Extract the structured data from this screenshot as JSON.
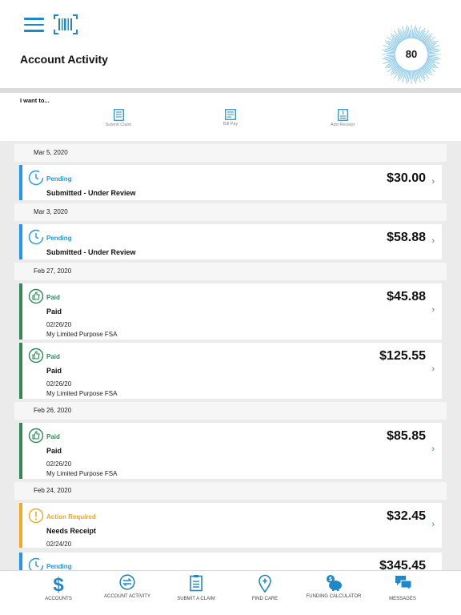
{
  "colors": {
    "accent": "#1e88c8",
    "pending": "#2196f3",
    "paid": "#2e8b57",
    "action_required": "#f5a623"
  },
  "header": {
    "title": "Account Activity",
    "score": "80",
    "icons": [
      "hamburger-menu-icon",
      "barcode-scan-icon"
    ]
  },
  "quick_actions": {
    "label": "I want to...",
    "items": [
      {
        "label": "Submit Claim",
        "icon": "claim-form-icon"
      },
      {
        "label": "Bill Pay",
        "icon": "bill-icon"
      },
      {
        "label": "Add Receipt",
        "icon": "receipt-icon"
      }
    ]
  },
  "activity": [
    {
      "date": "Mar 5, 2020",
      "items": [
        {
          "status": "Pending",
          "type": "pending",
          "title": "Submitted - Under Review",
          "amount": "$30.00"
        }
      ]
    },
    {
      "date": "Mar 3, 2020",
      "items": [
        {
          "status": "Pending",
          "type": "pending",
          "title": "Submitted - Under Review",
          "amount": "$58.88"
        }
      ]
    },
    {
      "date": "Feb 27, 2020",
      "items": [
        {
          "status": "Paid",
          "type": "paid",
          "title": "Paid",
          "date": "02/26/20",
          "plan": "My Limited Purpose FSA",
          "amount": "$45.88"
        },
        {
          "status": "Paid",
          "type": "paid",
          "title": "Paid",
          "date": "02/26/20",
          "plan": "My Limited Purpose FSA",
          "amount": "$125.55"
        }
      ]
    },
    {
      "date": "Feb 26, 2020",
      "items": [
        {
          "status": "Paid",
          "type": "paid",
          "title": "Paid",
          "date": "02/26/20",
          "plan": "My Limited Purpose FSA",
          "amount": "$85.85"
        }
      ]
    },
    {
      "date": "Feb 24, 2020",
      "items": [
        {
          "status": "Action Required",
          "type": "action",
          "title": "Needs Receipt",
          "date": "02/24/20",
          "amount": "$32.45"
        },
        {
          "status": "Pending",
          "type": "pending",
          "title": "",
          "amount": "$345.45"
        }
      ]
    }
  ],
  "tabbar": [
    {
      "label": "Accounts",
      "icon": "dollar-icon"
    },
    {
      "label": "Account Activity",
      "icon": "exchange-arrows-icon"
    },
    {
      "label": "Submit a Claim",
      "icon": "clipboard-icon"
    },
    {
      "label": "Find Care",
      "icon": "location-pin-plus-icon"
    },
    {
      "label": "Funding Calculator",
      "icon": "piggy-bank-icon"
    },
    {
      "label": "Messages",
      "icon": "chat-bubbles-icon"
    }
  ]
}
